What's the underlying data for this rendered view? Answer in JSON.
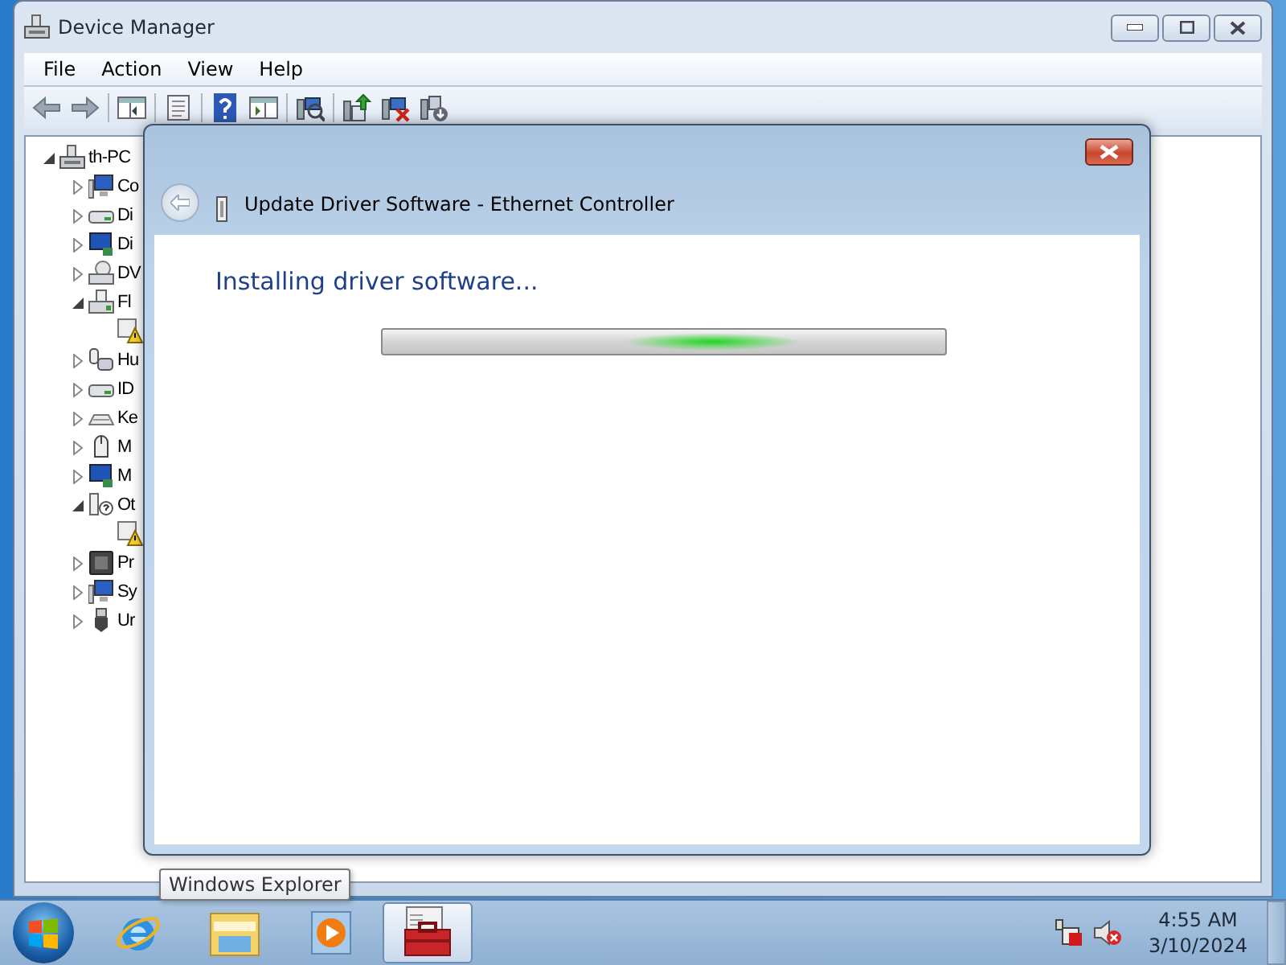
{
  "window": {
    "title": "Device Manager"
  },
  "menu": [
    "File",
    "Action",
    "View",
    "Help"
  ],
  "toolbar": [
    {
      "kind": "back"
    },
    {
      "kind": "forward"
    },
    {
      "kind": "sep"
    },
    {
      "kind": "tree"
    },
    {
      "kind": "sep"
    },
    {
      "kind": "properties"
    },
    {
      "kind": "sep"
    },
    {
      "kind": "help"
    },
    {
      "kind": "pane"
    },
    {
      "kind": "sep"
    },
    {
      "kind": "scan"
    },
    {
      "kind": "sep"
    },
    {
      "kind": "update"
    },
    {
      "kind": "disable"
    },
    {
      "kind": "uninstall"
    }
  ],
  "tree": {
    "label": "th-PC",
    "expanded": true,
    "children": [
      {
        "label": "Co",
        "kind": "computer",
        "expanded": false
      },
      {
        "label": "Di",
        "kind": "drive",
        "expanded": false
      },
      {
        "label": "Di",
        "kind": "display",
        "expanded": false
      },
      {
        "label": "DV",
        "kind": "disc",
        "expanded": false
      },
      {
        "label": "Fl",
        "kind": "floppy",
        "expanded": true,
        "children": [
          {
            "kind": "warning"
          }
        ]
      },
      {
        "label": "Hu",
        "kind": "hid",
        "expanded": false
      },
      {
        "label": "ID",
        "kind": "drive",
        "expanded": false
      },
      {
        "label": "Ke",
        "kind": "keyboard",
        "expanded": false
      },
      {
        "label": "M",
        "kind": "mouse",
        "expanded": false
      },
      {
        "label": "M",
        "kind": "display",
        "expanded": false
      },
      {
        "label": "Ot",
        "kind": "unknown",
        "expanded": true,
        "children": [
          {
            "kind": "warning"
          }
        ]
      },
      {
        "label": "Pr",
        "kind": "chip",
        "expanded": false
      },
      {
        "label": "Sy",
        "kind": "computer",
        "expanded": false
      },
      {
        "label": "Ur",
        "kind": "usb",
        "expanded": false
      }
    ]
  },
  "dialog": {
    "title": "Update Driver Software - Ethernet Controller",
    "heading": "Installing driver software...",
    "progress": {
      "indeterminate": true
    }
  },
  "tooltip": "Windows Explorer",
  "taskbar": {
    "items": [
      {
        "kind": "browser",
        "selected": false
      },
      {
        "kind": "folder",
        "selected": false
      },
      {
        "kind": "media",
        "selected": false
      },
      {
        "kind": "toolbox",
        "selected": true
      }
    ],
    "tray": [
      {
        "kind": "network"
      },
      {
        "kind": "speaker"
      }
    ],
    "time": "4:55 AM",
    "date": "3/10/2024"
  }
}
